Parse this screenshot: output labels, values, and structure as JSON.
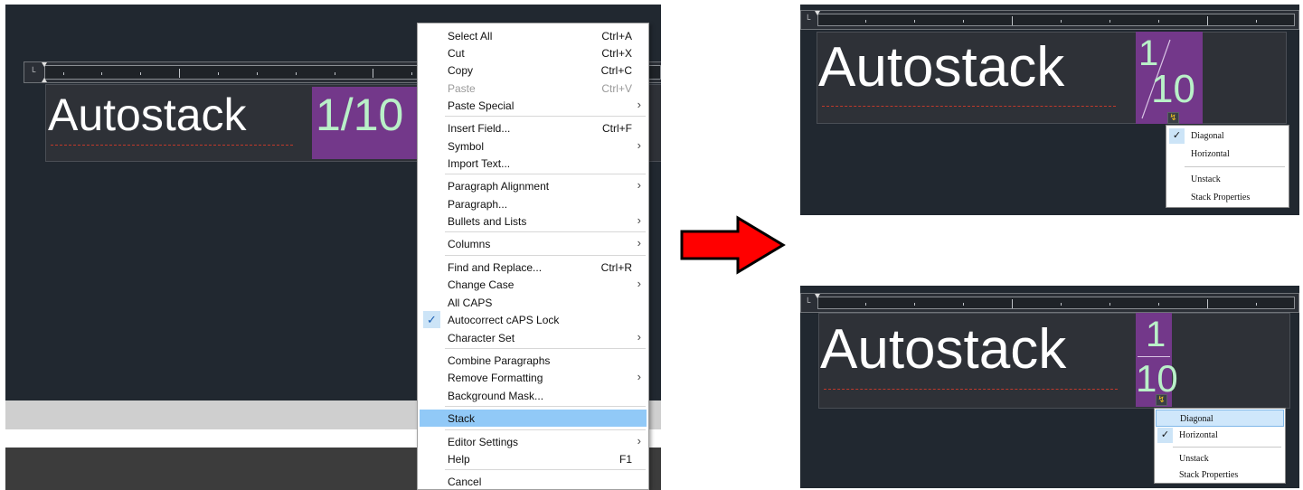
{
  "editor_text": {
    "word": "Autostack",
    "fraction": "1/10",
    "numerator": "1",
    "denominator": "10"
  },
  "context_menu": {
    "items": [
      {
        "label": "Select All",
        "shortcut": "Ctrl+A"
      },
      {
        "label": "Cut",
        "shortcut": "Ctrl+X"
      },
      {
        "label": "Copy",
        "shortcut": "Ctrl+C"
      },
      {
        "label": "Paste",
        "shortcut": "Ctrl+V"
      },
      {
        "label": "Paste Special"
      },
      {
        "label": "Insert Field...",
        "shortcut": "Ctrl+F"
      },
      {
        "label": "Symbol"
      },
      {
        "label": "Import Text..."
      },
      {
        "label": "Paragraph Alignment"
      },
      {
        "label": "Paragraph..."
      },
      {
        "label": "Bullets and Lists"
      },
      {
        "label": "Columns"
      },
      {
        "label": "Find and Replace...",
        "shortcut": "Ctrl+R"
      },
      {
        "label": "Change Case"
      },
      {
        "label": "All CAPS"
      },
      {
        "label": "Autocorrect cAPS Lock"
      },
      {
        "label": "Character Set"
      },
      {
        "label": "Combine Paragraphs"
      },
      {
        "label": "Remove Formatting"
      },
      {
        "label": "Background Mask..."
      },
      {
        "label": "Stack"
      },
      {
        "label": "Editor Settings"
      },
      {
        "label": "Help",
        "shortcut": "F1"
      },
      {
        "label": "Cancel"
      }
    ]
  },
  "stack_menu_diagonal": {
    "items": [
      "Diagonal",
      "Horizontal",
      "Unstack",
      "Stack Properties"
    ]
  },
  "stack_menu_horizontal": {
    "items": [
      "Diagonal",
      "Horizontal",
      "Unstack",
      "Stack Properties"
    ]
  },
  "colors": {
    "canvas": "#212830",
    "fraction_highlight": "#73388a",
    "fraction_text": "#b9f0c8",
    "menu_highlight": "#91c9f7",
    "arrow_fill": "#ff0000"
  },
  "icons": {
    "checkmark": "check-icon",
    "submenu": "chevron-right-icon",
    "autostack_options": "lightning-icon",
    "transition": "right-arrow-icon"
  }
}
